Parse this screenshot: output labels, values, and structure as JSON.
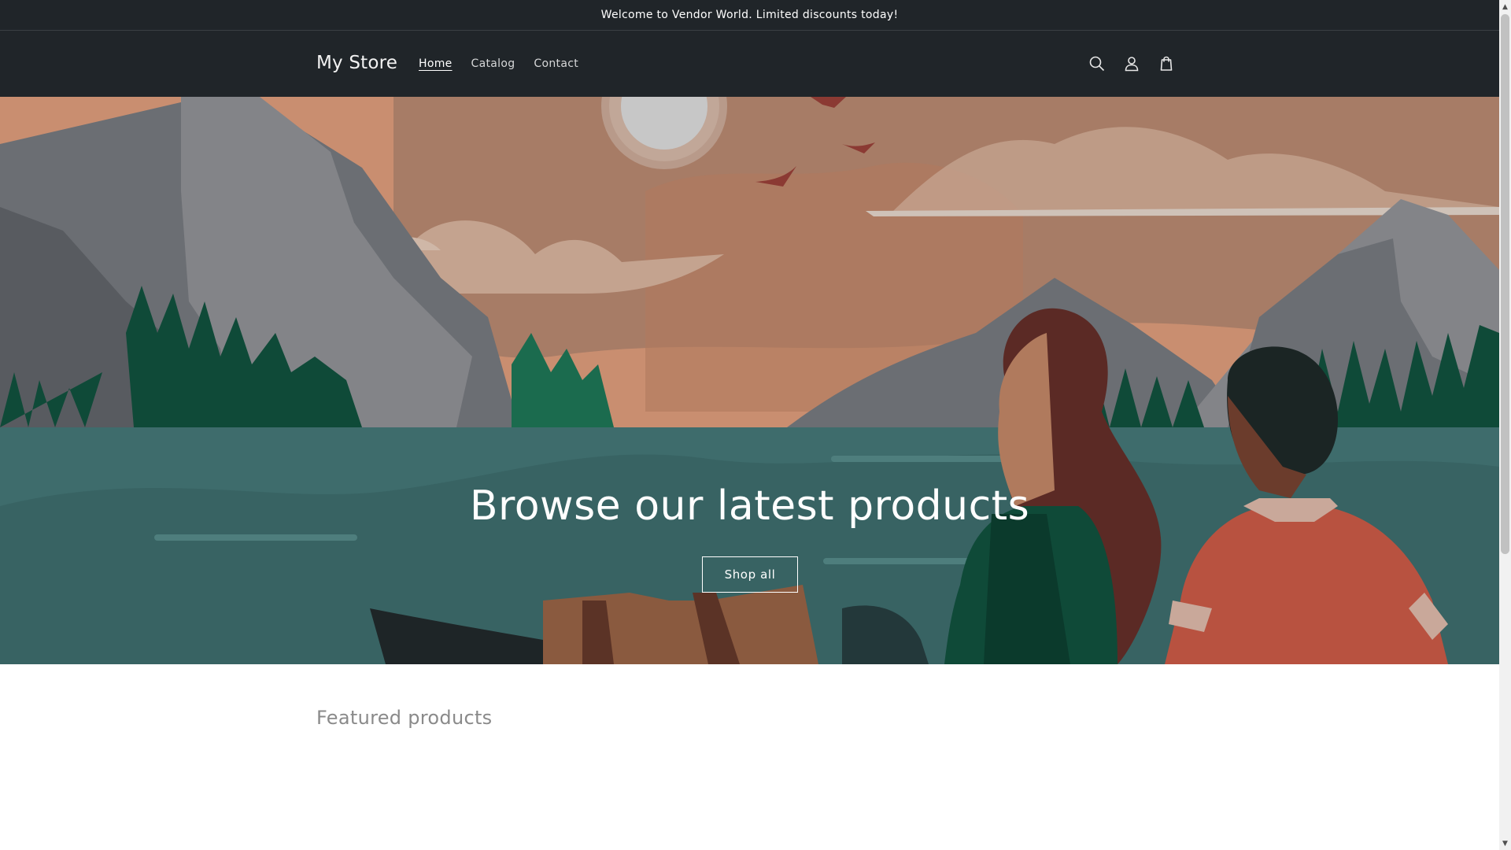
{
  "announcement": {
    "text": "Welcome to Vendor World. Limited discounts today!"
  },
  "header": {
    "logo": "My Store",
    "nav": [
      {
        "label": "Home",
        "active": true
      },
      {
        "label": "Catalog",
        "active": false
      },
      {
        "label": "Contact",
        "active": false
      }
    ],
    "icons": [
      "search-icon",
      "account-icon",
      "cart-icon"
    ]
  },
  "hero": {
    "title": "Browse our latest products",
    "button_label": "Shop all"
  },
  "featured": {
    "title": "Featured products"
  },
  "colors": {
    "header_bg": "#202529",
    "sky": "#c98e70",
    "water": "#3e6c6c",
    "tree": "#0f4a38"
  }
}
